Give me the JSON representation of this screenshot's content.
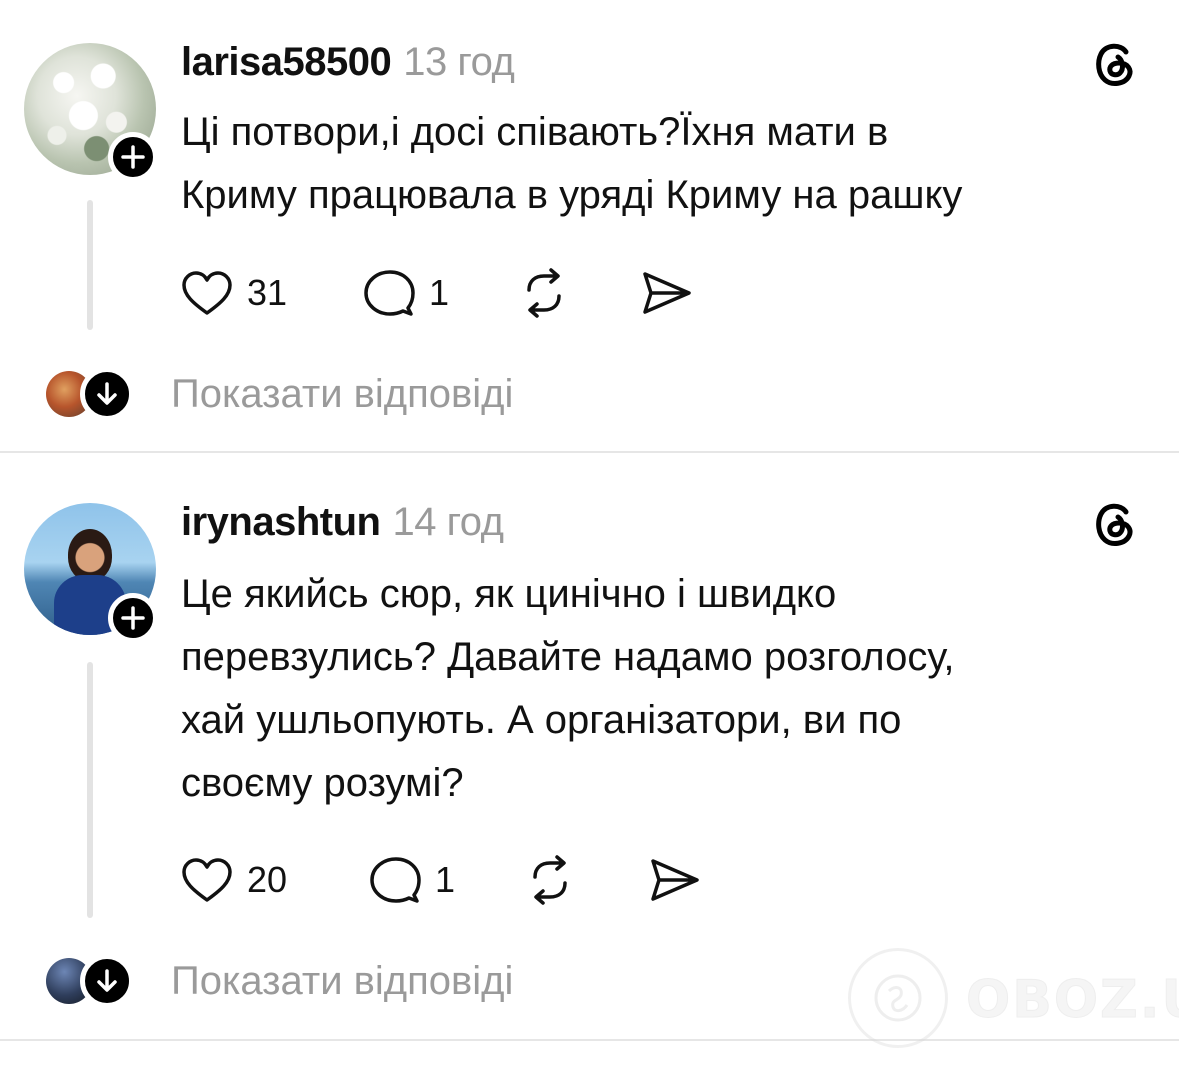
{
  "posts": [
    {
      "username": "larisa58500",
      "time": "13 год",
      "text_lines": [
        "Ці потвори,і досі співають?Їхня мати в",
        "Криму працювала в уряді Криму на рашку"
      ],
      "likes": "31",
      "comments": "1",
      "show_replies": "Показати відповіді"
    },
    {
      "username": "irynashtun",
      "time": "14 год",
      "text_lines": [
        "Це якийсь сюр, як цинічно і швидко",
        "перевзулись? Давайте надамо розголосу,",
        "хай ушльопують. А організатори, ви по",
        "своєму розумі?"
      ],
      "likes": "20",
      "comments": "1",
      "show_replies": "Показати відповіді"
    }
  ],
  "watermark": {
    "text": "OBOZ.UA"
  },
  "colors": {
    "text": "#111111",
    "muted": "#9a9a9a",
    "divider": "#e6e6e6"
  }
}
